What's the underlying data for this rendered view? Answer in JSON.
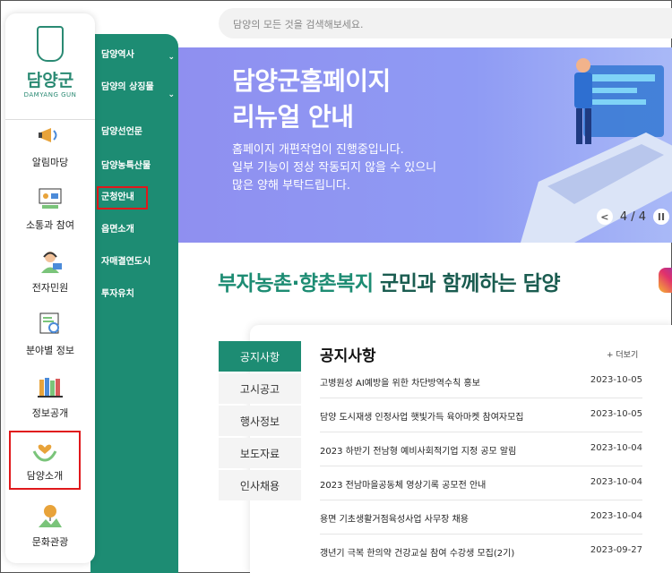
{
  "search": {
    "placeholder": "담양의 모든 것을 검색해보세요."
  },
  "logo": {
    "title": "담양군",
    "subtitle": "DAMYANG GUN"
  },
  "left_nav": [
    {
      "label": "알림마당",
      "icon": "megaphone-icon"
    },
    {
      "label": "소통과 참여",
      "icon": "presentation-icon"
    },
    {
      "label": "전자민원",
      "icon": "headset-agent-icon"
    },
    {
      "label": "분야별 정보",
      "icon": "document-search-icon"
    },
    {
      "label": "정보공개",
      "icon": "books-icon"
    },
    {
      "label": "담양소개",
      "icon": "hands-heart-icon",
      "highlighted": true
    },
    {
      "label": "문화관광",
      "icon": "balloon-landscape-icon"
    }
  ],
  "submenu": [
    {
      "label": "담양역사",
      "has_chevron": true
    },
    {
      "label": "담양의 상징물",
      "has_chevron": true
    },
    {
      "label": "담양선언문"
    },
    {
      "label": "담양농특산물"
    },
    {
      "label": "군청안내",
      "highlighted": true
    },
    {
      "label": "읍면소개"
    },
    {
      "label": "자매결연도시"
    },
    {
      "label": "투자유치"
    }
  ],
  "banner": {
    "title_line1": "담양군홈페이지",
    "title_line2": "리뉴얼 안내",
    "desc_line1": "홈페이지 개편작업이 진행중입니다.",
    "desc_line2": "일부 기능이 정상 작동되지 않을 수 있으니",
    "desc_line3": "많은 양해 부탁드립니다.",
    "counter": "4 / 4",
    "prev": "<",
    "pause": "II"
  },
  "slogan": {
    "part1": "부자농촌·향촌복지",
    "part2": "군민과 함께하는 담양"
  },
  "tabs": [
    "공지사항",
    "고시공고",
    "행사정보",
    "보도자료",
    "인사채용"
  ],
  "news": {
    "title": "공지사항",
    "more": "+ 더보기",
    "items": [
      {
        "title": "고병원성 AI예방을 위한 차단방역수칙 홍보",
        "date": "2023-10-05"
      },
      {
        "title": "담양 도시재생 인정사업 햇빛가득 육아마켓 참여자모집",
        "date": "2023-10-05"
      },
      {
        "title": "2023 하반기 전남형 예비사회적기업 지정 공모 알림",
        "date": "2023-10-04"
      },
      {
        "title": "2023 전남마을공동체 영상기록 공모전 안내",
        "date": "2023-10-04"
      },
      {
        "title": "용면 기초생활거점육성사업 사무장 채용",
        "date": "2023-10-04"
      },
      {
        "title": "갱년기 극복 한의약 건강교실 참여 수강생 모집(2기)",
        "date": "2023-09-27"
      }
    ]
  },
  "colors": {
    "green": "#1d8c73",
    "banner": "#8f8ff0",
    "highlight": "#e0181b"
  }
}
